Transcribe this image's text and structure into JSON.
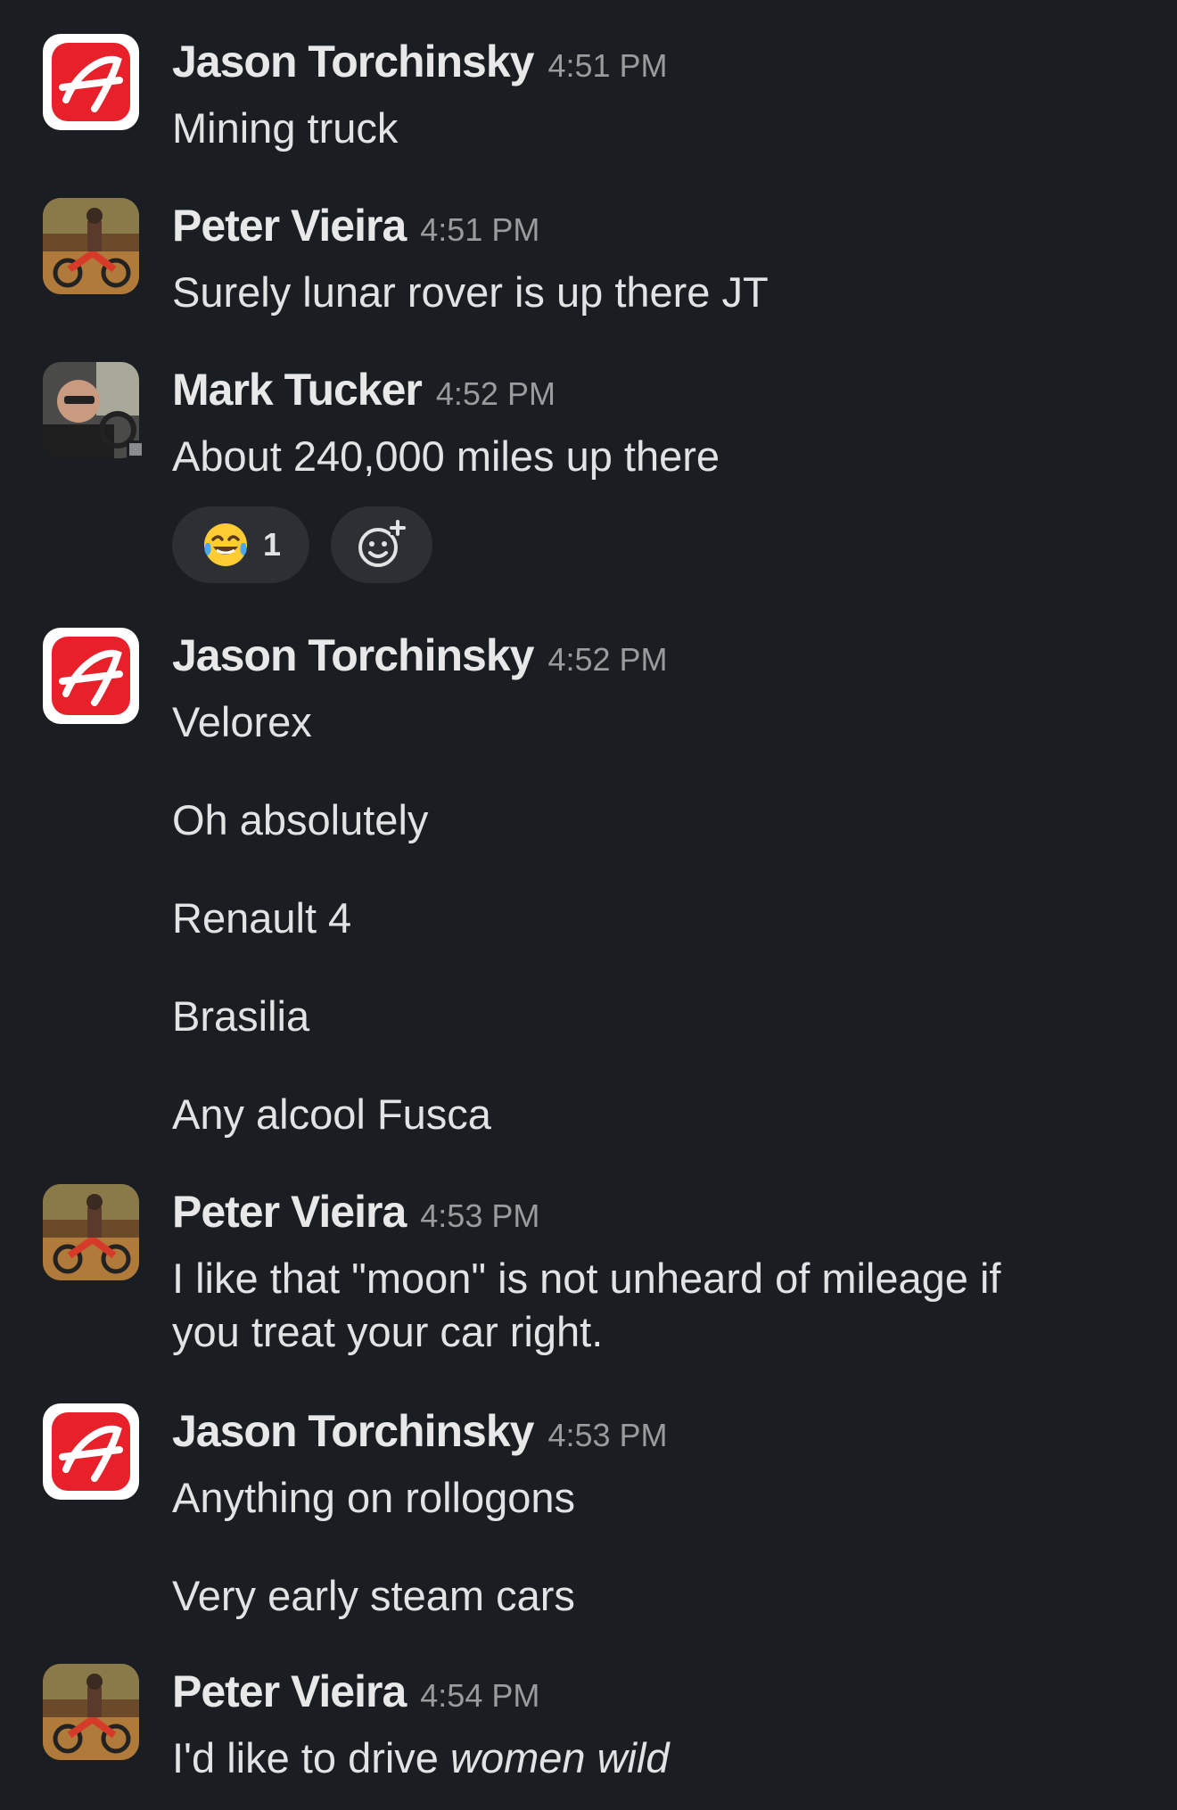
{
  "colors": {
    "background": "#1a1d21",
    "author": "#e8e8e8",
    "timestamp": "#9a9b9d",
    "body_text": "#e2e3e4",
    "reaction_bg": "#2c2f33",
    "brand_red": "#e8202a"
  },
  "messages": [
    {
      "author": "Jason Torchinsky",
      "avatar": "jalopnik-logo-icon",
      "time": "4:51 PM",
      "lines": [
        "Mining truck"
      ]
    },
    {
      "author": "Peter Vieira",
      "avatar": "dirt-bike-photo",
      "time": "4:51 PM",
      "lines": [
        "Surely lunar rover is up there JT"
      ]
    },
    {
      "author": "Mark Tucker",
      "avatar": "driver-photo",
      "time": "4:52 PM",
      "lines": [
        "About 240,000 miles up there"
      ],
      "reactions": [
        {
          "emoji": "tears-of-joy-emoji-icon",
          "count": "1"
        }
      ],
      "add_reaction_icon": "add-reaction-icon"
    },
    {
      "author": "Jason Torchinsky",
      "avatar": "jalopnik-logo-icon",
      "time": "4:52 PM",
      "lines": [
        "Velorex",
        "Oh absolutely",
        "Renault 4",
        "Brasilia",
        "Any alcool Fusca"
      ]
    },
    {
      "author": "Peter Vieira",
      "avatar": "dirt-bike-photo",
      "time": "4:53 PM",
      "lines": [
        "I like that \"moon\" is not unheard of mileage if",
        "you treat your car right."
      ]
    },
    {
      "author": "Jason Torchinsky",
      "avatar": "jalopnik-logo-icon",
      "time": "4:53 PM",
      "lines": [
        "Anything on rollogons",
        "Very early steam cars"
      ]
    },
    {
      "author": "Peter Vieira",
      "avatar": "dirt-bike-photo",
      "time": "4:54 PM",
      "lines": [
        "I'd like to drive "
      ],
      "italic_tail": "women wild"
    }
  ]
}
